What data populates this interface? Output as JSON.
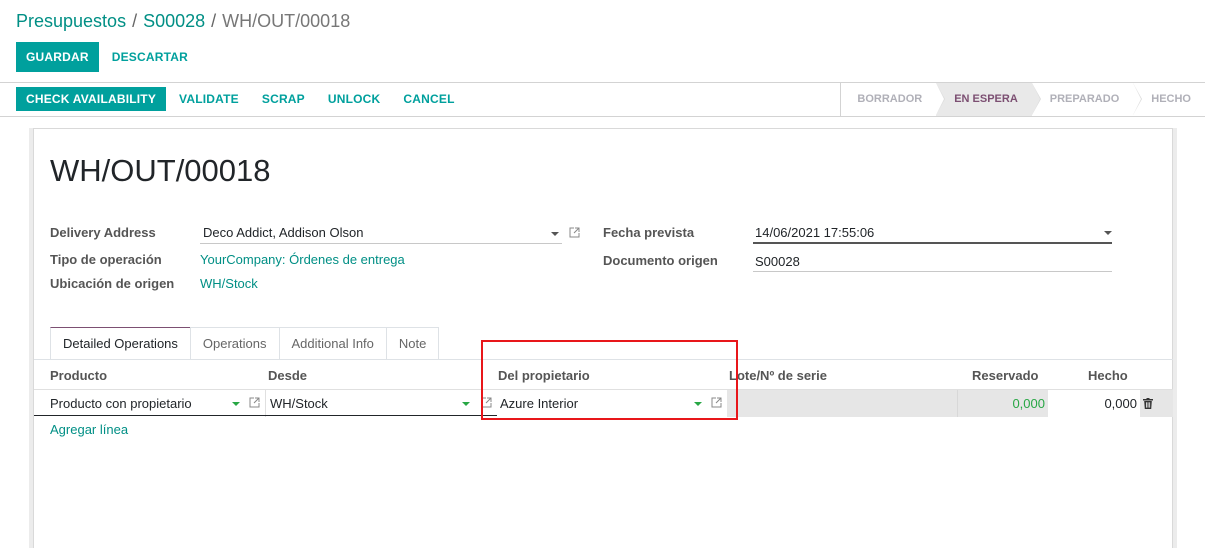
{
  "breadcrumb": {
    "items": [
      "Presupuestos",
      "S00028"
    ],
    "current": "WH/OUT/00018",
    "separator": "/"
  },
  "control_buttons": {
    "save": "GUARDAR",
    "discard": "DESCARTAR"
  },
  "header_buttons": {
    "check_availability": "CHECK AVAILABILITY",
    "validate": "VALIDATE",
    "scrap": "SCRAP",
    "unlock": "UNLOCK",
    "cancel": "CANCEL"
  },
  "statusbar": {
    "steps": [
      "BORRADOR",
      "EN ESPERA",
      "PREPARADO",
      "HECHO"
    ],
    "active": "EN ESPERA"
  },
  "record": {
    "title": "WH/OUT/00018",
    "fields": {
      "delivery_address": {
        "label": "Delivery Address",
        "value": "Deco Addict, Addison Olson"
      },
      "operation_type": {
        "label": "Tipo de operación",
        "value": "YourCompany: Órdenes de entrega"
      },
      "source_location": {
        "label": "Ubicación de origen",
        "value": "WH/Stock"
      },
      "scheduled_date": {
        "label": "Fecha prevista",
        "value": "14/06/2021 17:55:06"
      },
      "source_document": {
        "label": "Documento origen",
        "value": "S00028"
      }
    }
  },
  "tabs": [
    "Detailed Operations",
    "Operations",
    "Additional Info",
    "Note"
  ],
  "active_tab": "Detailed Operations",
  "table": {
    "columns": [
      "Producto",
      "Desde",
      "Del propietario",
      "Lote/Nº de serie",
      "Reservado",
      "Hecho"
    ],
    "rows": [
      {
        "product": "Producto con propietario",
        "from": "WH/Stock",
        "owner": "Azure Interior",
        "lot": "",
        "reserved": "0,000",
        "done": "0,000"
      }
    ],
    "add_line": "Agregar línea"
  },
  "colors": {
    "primary": "#00a09d",
    "link": "#018f85",
    "active_status": "#7c4f72",
    "highlight": "#e8161a"
  }
}
